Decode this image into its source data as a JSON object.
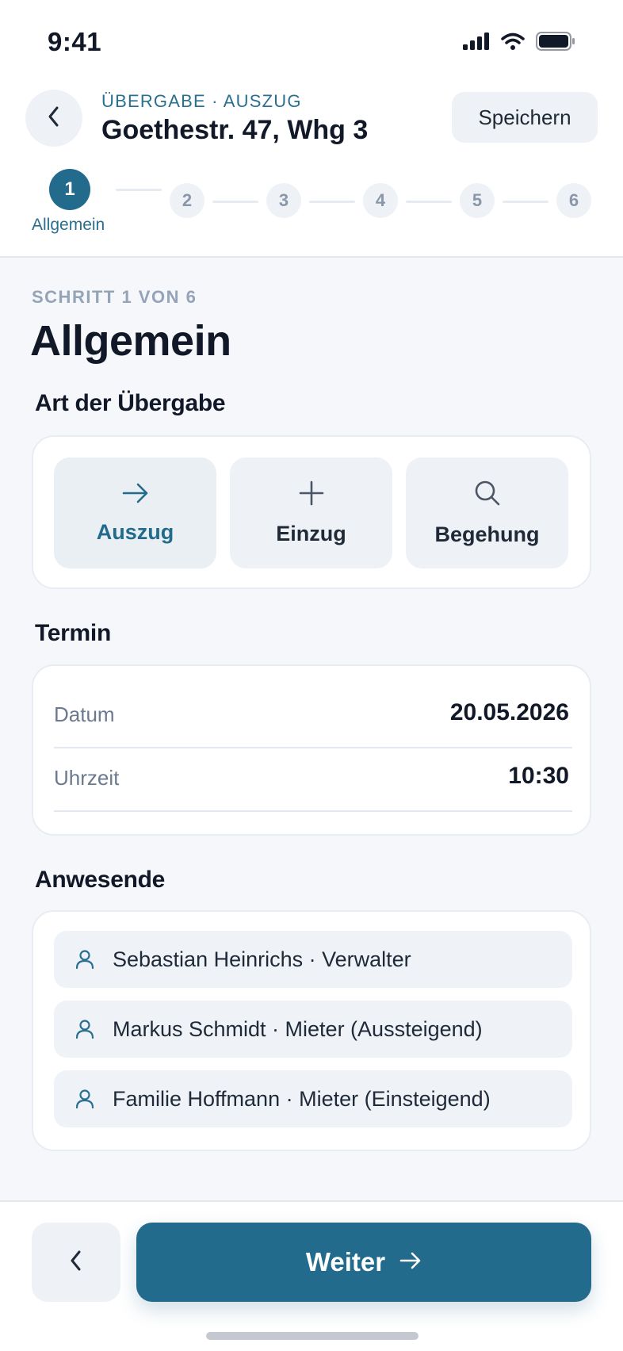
{
  "status_bar": {
    "time": "9:41"
  },
  "header": {
    "eyebrow": "ÜBERGABE · AUSZUG",
    "address": "Goethestr. 47, Whg 3",
    "save_label": "Speichern"
  },
  "stepper": {
    "steps": [
      "1",
      "2",
      "3",
      "4",
      "5",
      "6"
    ],
    "active_index": 0,
    "active_label": "Allgemein"
  },
  "page": {
    "kicker": "SCHRITT 1 VON 6",
    "title": "Allgemein"
  },
  "handover_type": {
    "title": "Art der Übergabe",
    "options": [
      {
        "label": "Auszug",
        "icon": "arrow-right-icon",
        "selected": true
      },
      {
        "label": "Einzug",
        "icon": "plus-icon",
        "selected": false
      },
      {
        "label": "Begehung",
        "icon": "search-icon",
        "selected": false
      }
    ]
  },
  "appointment": {
    "title": "Termin",
    "date_label": "Datum",
    "date_value": "20.05.2026",
    "time_label": "Uhrzeit",
    "time_value": "10:30"
  },
  "attendees": {
    "title": "Anwesende",
    "people": [
      "Sebastian Heinrichs · Verwalter",
      "Markus Schmidt · Mieter (Aussteigend)",
      "Familie Hoffmann · Mieter (Einsteigend)"
    ]
  },
  "footer": {
    "next_label": "Weiter"
  },
  "colors": {
    "accent": "#236b8c",
    "accent_text": "#2a6f8f",
    "background": "#f5f7fa",
    "muted": "#94a3b8"
  }
}
